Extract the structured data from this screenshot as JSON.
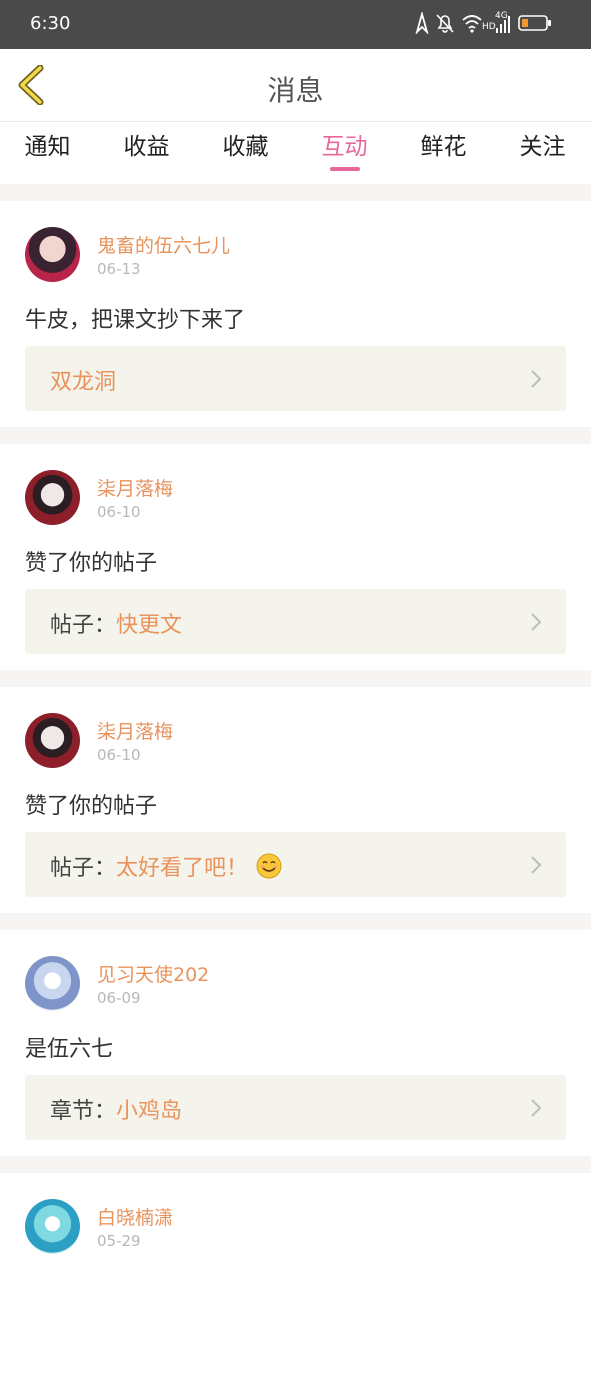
{
  "status_bar": {
    "time": "6:30",
    "network": "4G",
    "hd": "HD"
  },
  "header": {
    "title": "消息"
  },
  "tabs": [
    {
      "label": "通知"
    },
    {
      "label": "收益"
    },
    {
      "label": "收藏"
    },
    {
      "label": "互动",
      "active": true
    },
    {
      "label": "鲜花"
    },
    {
      "label": "关注"
    }
  ],
  "messages": [
    {
      "user": "鬼畜的伍六七儿",
      "date": "06-13",
      "text": "牛皮，把课文抄下来了",
      "ref_prefix": "",
      "ref_target": "双龙洞",
      "ref_emoji": ""
    },
    {
      "user": "柒月落梅",
      "date": "06-10",
      "text": "赞了你的帖子",
      "ref_prefix": "帖子：",
      "ref_target": "快更文",
      "ref_emoji": ""
    },
    {
      "user": "柒月落梅",
      "date": "06-10",
      "text": "赞了你的帖子",
      "ref_prefix": "帖子：",
      "ref_target": "太好看了吧！",
      "ref_emoji": "smiling-face-icon"
    },
    {
      "user": "见习天使202",
      "date": "06-09",
      "text": "是伍六七",
      "ref_prefix": "章节：",
      "ref_target": "小鸡岛",
      "ref_emoji": ""
    },
    {
      "user": "白晓楠潇",
      "date": "05-29",
      "text": "",
      "ref_prefix": "",
      "ref_target": "",
      "ref_emoji": ""
    }
  ],
  "colors": {
    "accent_pink": "#e8679c",
    "username_orange": "#e9935c",
    "ref_bg": "#f4f4ec",
    "status_bar": "#4a4a4a"
  }
}
